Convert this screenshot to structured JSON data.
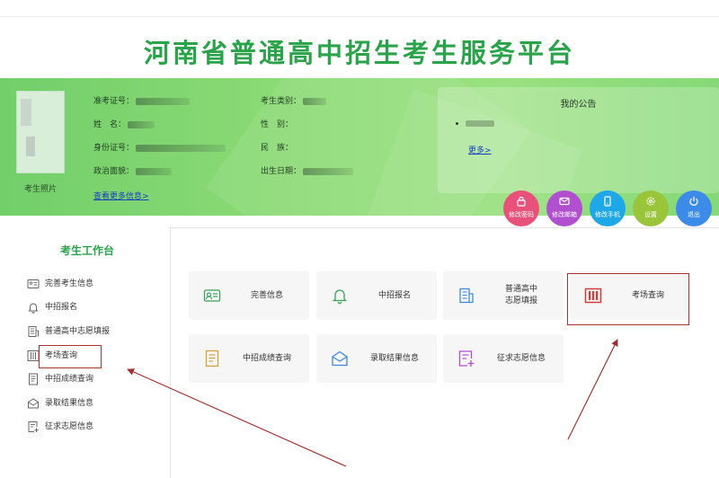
{
  "header": {
    "title": "河南省普通高中招生考生服务平台"
  },
  "profile": {
    "photo_label": "考生照片",
    "exam_no_label": "准考证号：",
    "name_label": "姓　名：",
    "id_label": "身份证号：",
    "political_label": "政治面貌：",
    "category_label": "考生类别：",
    "gender_label": "性　别：",
    "ethnicity_label": "民　族：",
    "birth_label": "出生日期：",
    "more_info_link": "查看更多信息>"
  },
  "notice": {
    "title": "我的公告",
    "more_link": "更多>"
  },
  "actions": [
    {
      "label": "修改密码",
      "icon": "lock-icon",
      "color": "#e8527a"
    },
    {
      "label": "修改邮箱",
      "icon": "mail-icon",
      "color": "#b04fd0"
    },
    {
      "label": "修改手机",
      "icon": "phone-icon",
      "color": "#1fa8e8"
    },
    {
      "label": "设置",
      "icon": "gear-icon",
      "color": "#9ac43a"
    },
    {
      "label": "退出",
      "icon": "power-icon",
      "color": "#3d8be8"
    }
  ],
  "sidebar": {
    "title": "考生工作台",
    "items": [
      {
        "label": "完善考生信息",
        "icon": "id-card-icon"
      },
      {
        "label": "中招报名",
        "icon": "bell-icon"
      },
      {
        "label": "普通高中志愿填报",
        "icon": "building-icon"
      },
      {
        "label": "考场查询",
        "icon": "columns-icon"
      },
      {
        "label": "中招成绩查询",
        "icon": "document-icon"
      },
      {
        "label": "录取结果信息",
        "icon": "envelope-icon"
      },
      {
        "label": "征求志愿信息",
        "icon": "form-add-icon"
      }
    ]
  },
  "cards": [
    {
      "label": "完善信息",
      "icon": "id-card-icon",
      "color": "#3aa05a"
    },
    {
      "label": "中招报名",
      "icon": "bell-icon",
      "color": "#3aa05a"
    },
    {
      "label": "普通高中\n志愿填报",
      "icon": "building-icon",
      "color": "#3d8be8"
    },
    {
      "label": "考场查询",
      "icon": "columns-icon",
      "color": "#d83a3a"
    },
    {
      "label": "中招成绩查询",
      "icon": "document-icon",
      "color": "#d8a03a"
    },
    {
      "label": "录取结果信息",
      "icon": "envelope-icon",
      "color": "#3d8be8"
    },
    {
      "label": "征求志愿信息",
      "icon": "form-add-icon",
      "color": "#b04fd0"
    }
  ]
}
